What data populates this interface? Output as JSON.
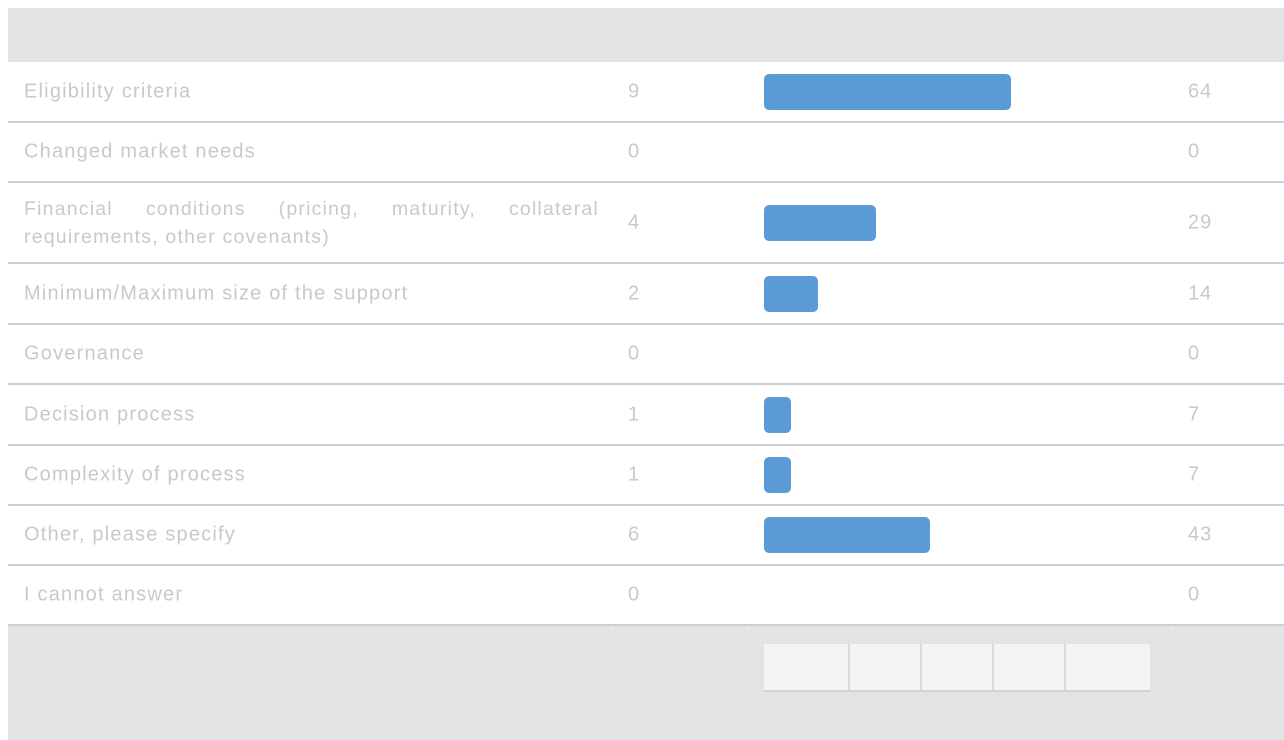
{
  "chart_data": {
    "type": "bar",
    "orientation": "horizontal",
    "categories": [
      "Eligibility criteria",
      "Changed market needs",
      "Financial conditions (pricing, maturity, collateral requirements, other covenants)",
      "Minimum/Maximum size of the support",
      "Governance",
      "Decision process",
      "Complexity of process",
      "Other, please specify",
      "I cannot answer"
    ],
    "counts": [
      "9",
      "0",
      "4",
      "2",
      "0",
      "1",
      "1",
      "6",
      "0"
    ],
    "percents": [
      "64",
      "0",
      "29",
      "14",
      "0",
      "7",
      "7",
      "43",
      "0"
    ],
    "values": [
      64,
      0,
      29,
      14,
      0,
      7,
      7,
      43,
      0
    ],
    "xlim": [
      0,
      100
    ],
    "bar_color": "#5b9bd5",
    "header_color": "#e2e3e4",
    "text_color": "#c7c9cc",
    "grid": false
  }
}
